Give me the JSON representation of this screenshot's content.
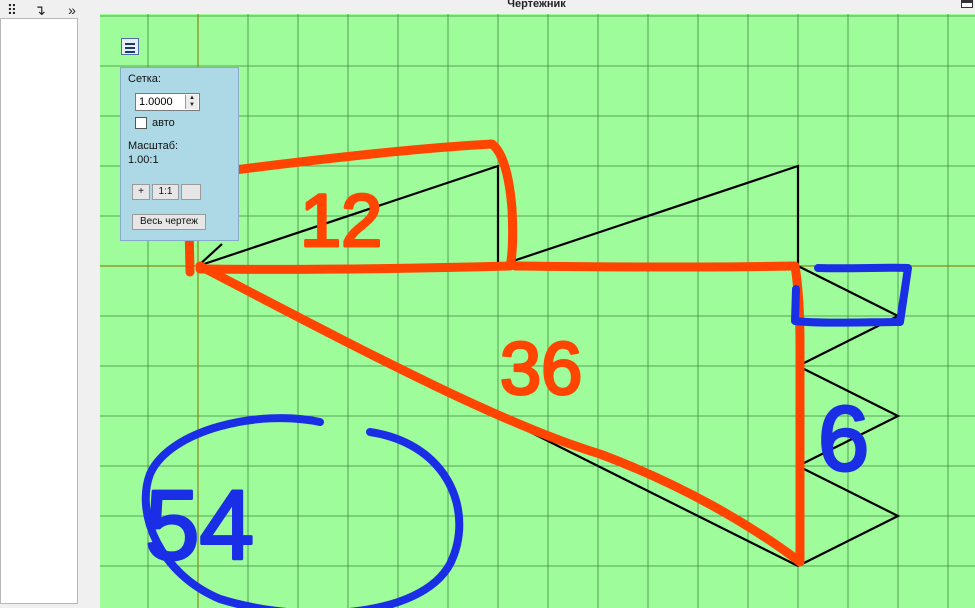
{
  "window": {
    "title": "Чертежник"
  },
  "left_toolbar": {
    "items": [
      {
        "icon": "move-points-icon",
        "glyph": "⠿"
      },
      {
        "icon": "step-into-icon",
        "glyph": "↴"
      },
      {
        "icon": "more-chevron-icon",
        "glyph": "»"
      }
    ]
  },
  "grid_panel": {
    "grid_label": "Сетка:",
    "grid_value": "1.0000",
    "auto_label": "авто",
    "auto_checked": false,
    "scale_label": "Масштаб:",
    "scale_value": "1.00:1",
    "zoom_in_label": "+",
    "reset_label": "1:1",
    "zoom_out_label": "",
    "fit_all_label": "Весь чертеж"
  },
  "annotations": {
    "red_top": "12",
    "red_middle": "36",
    "blue_right": "6",
    "blue_bottom_left": "54"
  },
  "colors": {
    "canvas_bg": "#9ffc9a",
    "grid_line": "#3d8a3d",
    "axis_line": "#8a8a1a",
    "figure": "#000000",
    "red_marker": "#ff4500",
    "blue_marker": "#1a2ee6",
    "panel_bg": "#add8e6"
  }
}
